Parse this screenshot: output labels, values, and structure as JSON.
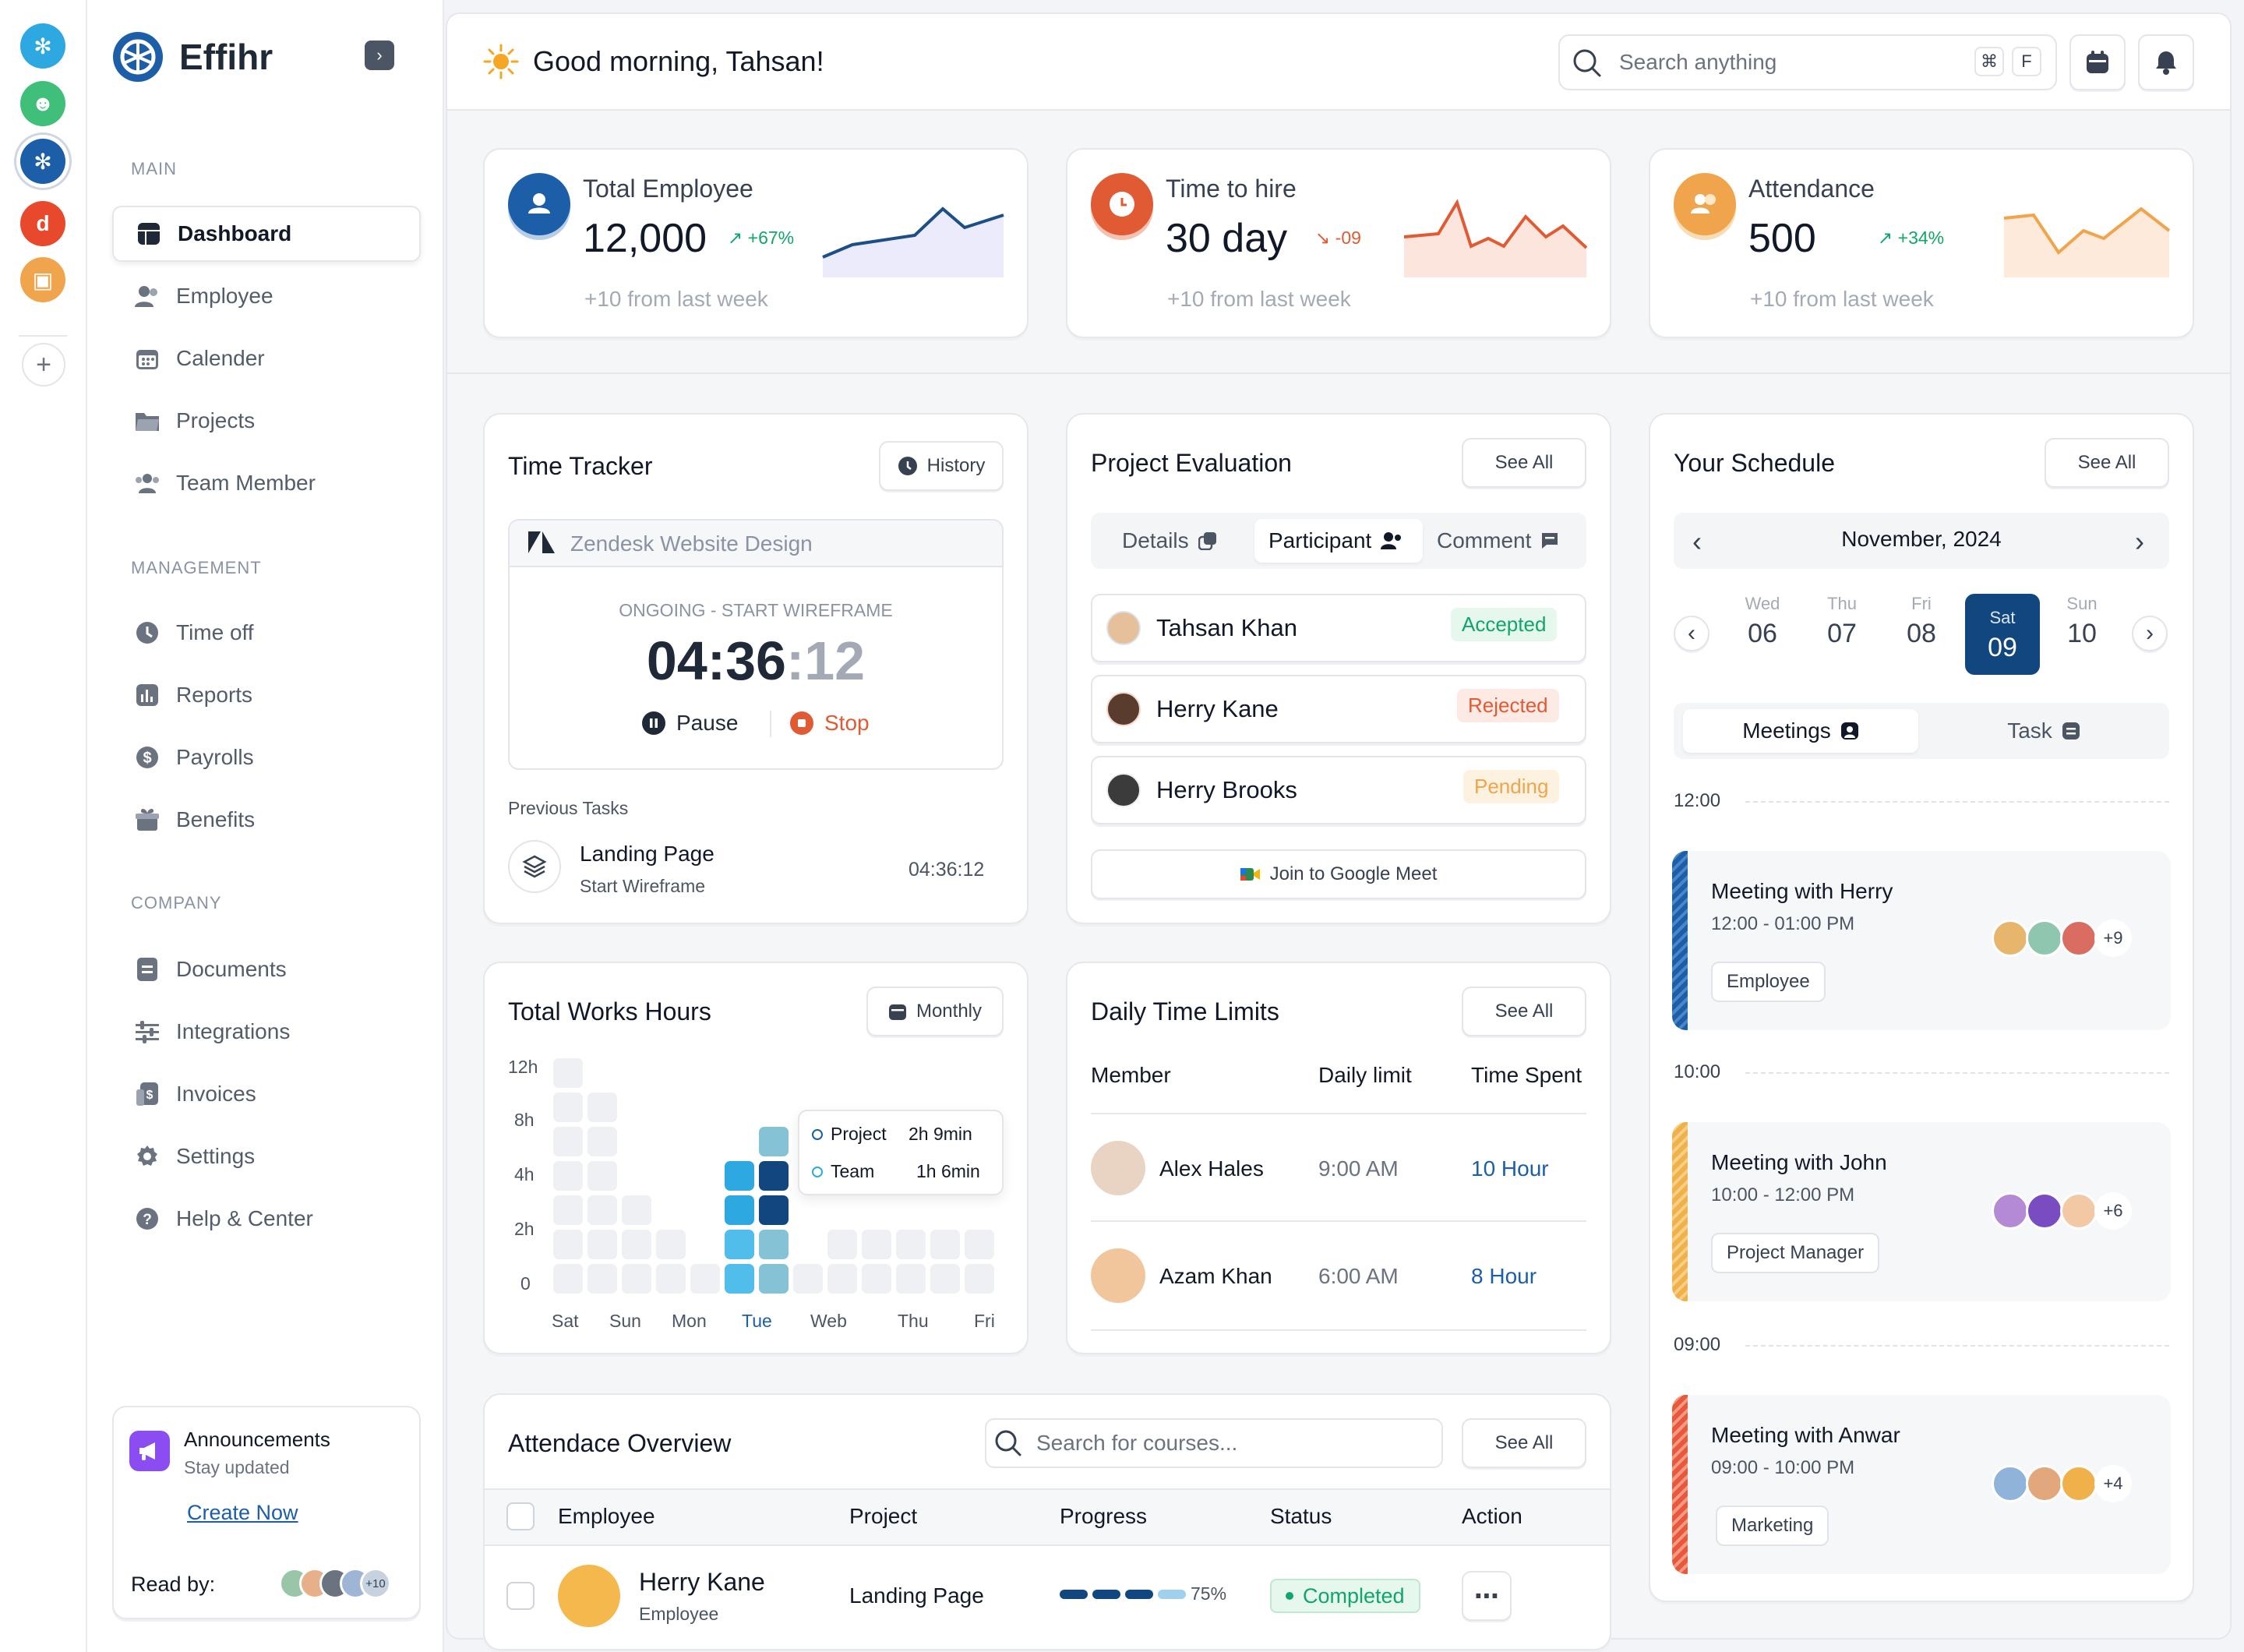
{
  "app": {
    "name": "Effihr"
  },
  "header": {
    "greeting": "Good morning, Tahsan!",
    "search_placeholder": "Search anything",
    "kbd1": "⌘",
    "kbd2": "F"
  },
  "sidebar": {
    "sections": [
      "MAIN",
      "MANAGEMENT",
      "COMPANY"
    ],
    "items": [
      {
        "label": "Dashboard",
        "icon": "dashboard-icon"
      },
      {
        "label": "Employee",
        "icon": "employee-icon"
      },
      {
        "label": "Calender",
        "icon": "calendar-icon"
      },
      {
        "label": "Projects",
        "icon": "folder-icon"
      },
      {
        "label": "Team Member",
        "icon": "team-icon"
      },
      {
        "label": "Time off",
        "icon": "clock-icon"
      },
      {
        "label": "Reports",
        "icon": "reports-icon"
      },
      {
        "label": "Payrolls",
        "icon": "dollar-icon"
      },
      {
        "label": "Benefits",
        "icon": "benefits-icon"
      },
      {
        "label": "Documents",
        "icon": "document-icon"
      },
      {
        "label": "Integrations",
        "icon": "sliders-icon"
      },
      {
        "label": "Invoices",
        "icon": "invoice-icon"
      },
      {
        "label": "Settings",
        "icon": "gear-icon"
      },
      {
        "label": "Help & Center",
        "icon": "help-icon"
      }
    ],
    "announce": {
      "title": "Announcements",
      "subtitle": "Stay updated",
      "link": "Create Now",
      "read_by": "Read by:",
      "extra": "+10"
    }
  },
  "stats": [
    {
      "title": "Total Employee",
      "value": "12,000",
      "delta": "+67%",
      "foot": "+10 from last week",
      "accent": "#1d5ea8"
    },
    {
      "title": "Time to hire",
      "value": "30 day",
      "delta": "-09",
      "foot": "+10 from last week",
      "accent": "#e05a33"
    },
    {
      "title": "Attendance",
      "value": "500",
      "delta": "+34%",
      "foot": "+10 from last week",
      "accent": "#f0a44b"
    }
  ],
  "tracker": {
    "title": "Time Tracker",
    "history": "History",
    "project": "Zendesk Website Design",
    "status": "ONGOING - START WIREFRAME",
    "time_main": "04:36",
    "time_sec": ":12",
    "pause": "Pause",
    "stop": "Stop",
    "prev_label": "Previous Tasks",
    "task_title": "Landing Page",
    "task_sub": "Start Wireframe",
    "task_time": "04:36:12"
  },
  "evaluation": {
    "title": "Project Evaluation",
    "see_all": "See All",
    "tabs": [
      "Details",
      "Participant",
      "Comment"
    ],
    "people": [
      {
        "name": "Tahsan Khan",
        "status": "Accepted"
      },
      {
        "name": "Herry Kane",
        "status": "Rejected"
      },
      {
        "name": "Herry Brooks",
        "status": "Pending"
      }
    ],
    "meet": "Join to Google Meet"
  },
  "schedule": {
    "title": "Your Schedule",
    "see_all": "See All",
    "month": "November, 2024",
    "days": [
      {
        "d": "Wed",
        "n": "06"
      },
      {
        "d": "Thu",
        "n": "07"
      },
      {
        "d": "Fri",
        "n": "08"
      },
      {
        "d": "Sat",
        "n": "09"
      },
      {
        "d": "Sun",
        "n": "10"
      }
    ],
    "tabs": [
      "Meetings",
      "Task"
    ],
    "times": [
      "12:00",
      "10:00",
      "09:00"
    ],
    "meetings": [
      {
        "title": "Meeting with Herry",
        "time": "12:00 - 01:00 PM",
        "tag": "Employee",
        "more": "+9",
        "color": "#1d5ea8"
      },
      {
        "title": "Meeting with John",
        "time": "10:00 - 12:00 PM",
        "tag": "Project Manager",
        "more": "+6",
        "color": "#f0b04a"
      },
      {
        "title": "Meeting with Anwar",
        "time": "09:00 - 10:00 PM",
        "tag": "Marketing",
        "more": "+4",
        "color": "#e8583a"
      }
    ]
  },
  "works": {
    "title": "Total Works Hours",
    "filter": "Monthly",
    "y_labels": [
      "12h",
      "8h",
      "4h",
      "2h",
      "0"
    ],
    "x_labels": [
      "Sat",
      "Sun",
      "Mon",
      "Tue",
      "Web",
      "Thu",
      "Fri"
    ],
    "tooltip": [
      {
        "label": "Project",
        "value": "2h 9min"
      },
      {
        "label": "Team",
        "value": "1h 6min"
      }
    ]
  },
  "limits": {
    "title": "Daily Time Limits",
    "see_all": "See All",
    "cols": [
      "Member",
      "Daily limit",
      "Time Spent"
    ],
    "rows": [
      {
        "name": "Alex Hales",
        "limit": "9:00 AM",
        "spent": "10 Hour"
      },
      {
        "name": "Azam Khan",
        "limit": "6:00 AM",
        "spent": "8 Hour"
      }
    ]
  },
  "attendance": {
    "title": "Attendace Overview",
    "search_placeholder": "Search for courses...",
    "see_all": "See All",
    "cols": [
      "Employee",
      "Project",
      "Progress",
      "Status",
      "Action"
    ],
    "rows": [
      {
        "name": "Herry Kane",
        "role": "Employee",
        "project": "Landing Page",
        "progress": "75%",
        "status": "Completed"
      }
    ]
  }
}
